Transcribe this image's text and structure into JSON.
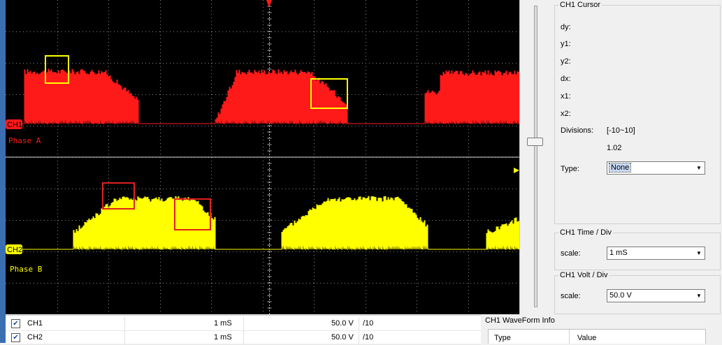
{
  "scope": {
    "ch1_marker": "CH1",
    "ch1_label": "Phase A",
    "ch2_marker": "CH2",
    "ch2_label": "Phase B",
    "colors": {
      "background": "#000000",
      "ch1": "#ff1a1a",
      "ch2": "#ffff00",
      "grid": "#8a8a8a",
      "yellow_box": "#ffff00",
      "red_box": "#e02020"
    }
  },
  "cursor_panel": {
    "title": "CH1 Cursor",
    "dy_label": "dy:",
    "y1_label": "y1:",
    "y2_label": "y2:",
    "dx_label": "dx:",
    "x1_label": "x1:",
    "x2_label": "x2:",
    "divisions_label": "Divisions:",
    "divisions_range": "[-10~10]",
    "divisions_value": "1.02",
    "type_label": "Type:",
    "type_value": "None"
  },
  "time_panel": {
    "title": "CH1 Time / Div",
    "scale_label": "scale:",
    "scale_value": "1  mS"
  },
  "volt_panel": {
    "title": "CH1 Volt / Div",
    "scale_label": "scale:",
    "scale_value": "50.0 V"
  },
  "channels": [
    {
      "name": "CH1",
      "checked": true,
      "time": "1  mS",
      "volt": "50.0 V",
      "div": "/10"
    },
    {
      "name": "CH2",
      "checked": true,
      "time": "1  mS",
      "volt": "50.0 V",
      "div": "/10"
    }
  ],
  "waveform_info": {
    "title": "CH1 WaveForm Info",
    "col_type": "Type",
    "col_value": "Value"
  },
  "icons": {
    "trigger": "trigger-marker-icon",
    "checkbox": "checkbox-checked-icon",
    "dropdown": "chevron-down-icon"
  }
}
